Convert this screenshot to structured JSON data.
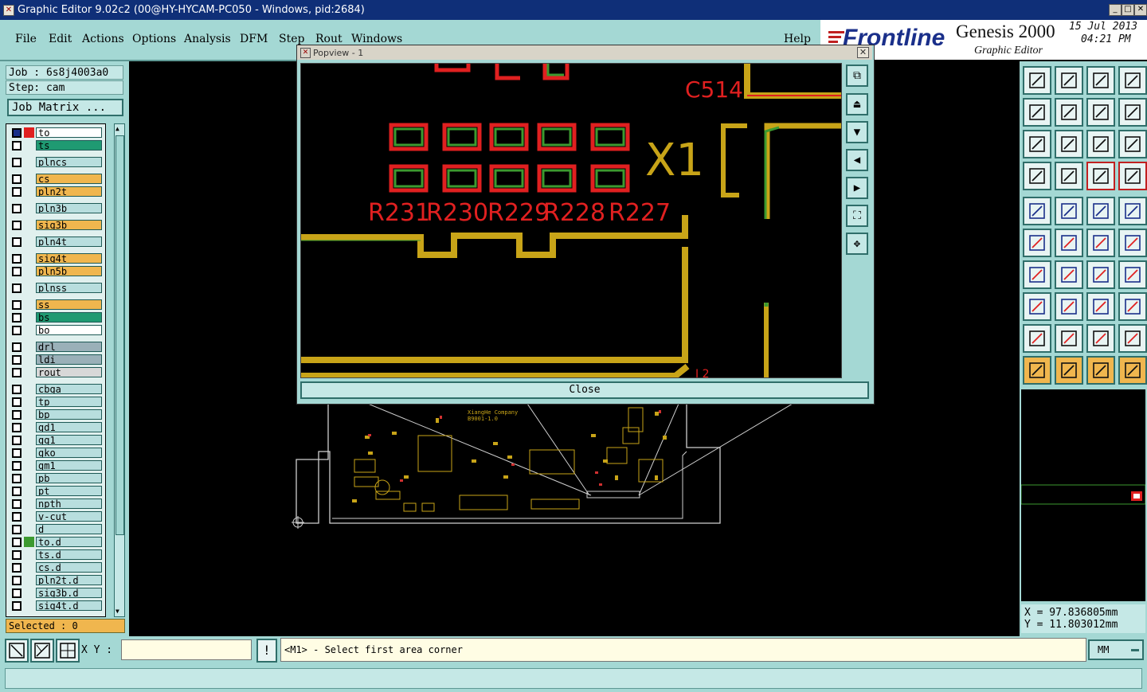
{
  "window": {
    "title": "Graphic Editor 9.02c2 (00@HY-HYCAM-PC050 - Windows, pid:2684)"
  },
  "menu": [
    "File",
    "Edit",
    "Actions",
    "Options",
    "Analysis",
    "DFM",
    "Step",
    "Rout",
    "Windows",
    "Help"
  ],
  "brand": {
    "logo": "Frontline",
    "product": "Genesis 2000",
    "subtitle": "Graphic Editor",
    "date": "15 Jul 2013",
    "time": "04:21 PM"
  },
  "job": {
    "job_label": "Job : 6s8j4003a0",
    "step_label": "Step: cam",
    "matrix_button": "Job Matrix ..."
  },
  "layers": [
    {
      "name": "to",
      "color": "#ffffff"
    },
    {
      "name": "ts",
      "color": "#1f9a72"
    },
    {
      "name": "plncs",
      "color": "#b8dede"
    },
    {
      "name": "cs",
      "color": "#f0b64e"
    },
    {
      "name": "pln2t",
      "color": "#f0b64e"
    },
    {
      "name": "pln3b",
      "color": "#b8dede"
    },
    {
      "name": "sig3b",
      "color": "#f0b64e"
    },
    {
      "name": "pln4t",
      "color": "#b8dede"
    },
    {
      "name": "sig4t",
      "color": "#f0b64e"
    },
    {
      "name": "pln5b",
      "color": "#f0b64e"
    },
    {
      "name": "plnss",
      "color": "#b8dede"
    },
    {
      "name": "ss",
      "color": "#f0b64e"
    },
    {
      "name": "bs",
      "color": "#1f9a72"
    },
    {
      "name": "bo",
      "color": "#ffffff"
    },
    {
      "name": "drl",
      "color": "#9ab0b8"
    },
    {
      "name": "ldi",
      "color": "#9ab0b8"
    },
    {
      "name": "rout",
      "color": "#d8d8d8"
    },
    {
      "name": "cbga",
      "color": "#b8dede"
    },
    {
      "name": "tp",
      "color": "#b8dede"
    },
    {
      "name": "bp",
      "color": "#b8dede"
    },
    {
      "name": "gd1",
      "color": "#b8dede"
    },
    {
      "name": "gg1",
      "color": "#b8dede"
    },
    {
      "name": "gko",
      "color": "#b8dede"
    },
    {
      "name": "gm1",
      "color": "#b8dede"
    },
    {
      "name": "pb",
      "color": "#b8dede"
    },
    {
      "name": "pt",
      "color": "#b8dede"
    },
    {
      "name": "npth",
      "color": "#b8dede"
    },
    {
      "name": "v-cut",
      "color": "#b8dede"
    },
    {
      "name": "d",
      "color": "#b8dede"
    },
    {
      "name": "to.d",
      "color": "#b8dede"
    },
    {
      "name": "ts.d",
      "color": "#b8dede"
    },
    {
      "name": "cs.d",
      "color": "#b8dede"
    },
    {
      "name": "pln2t.d",
      "color": "#b8dede"
    },
    {
      "name": "sig3b.d",
      "color": "#b8dede"
    },
    {
      "name": "sig4t.d",
      "color": "#b8dede"
    }
  ],
  "selected_label": "Selected : 0",
  "popup": {
    "title": "Popview - 1",
    "close_label": "Close",
    "labels": {
      "c514": "C514",
      "x1": "X1",
      "r231": "R231",
      "r230": "R230",
      "r229": "R229",
      "r228": "R228",
      "r227": "R227"
    }
  },
  "board": {
    "company": "XiangHe Company",
    "part": "B9001-1.0"
  },
  "coords": {
    "x": "X = 97.836805mm",
    "y": "Y = 11.803012mm"
  },
  "status": {
    "xy_label": "X Y :",
    "xy_value": "",
    "prompt": "<M1> - Select first area corner",
    "units": "MM"
  },
  "colors": {
    "accent": "#a4d8d4",
    "title": "#0f2f78",
    "copper": "#c8a418",
    "pad_red": "#e02020",
    "pad_green": "#3c9a30"
  }
}
